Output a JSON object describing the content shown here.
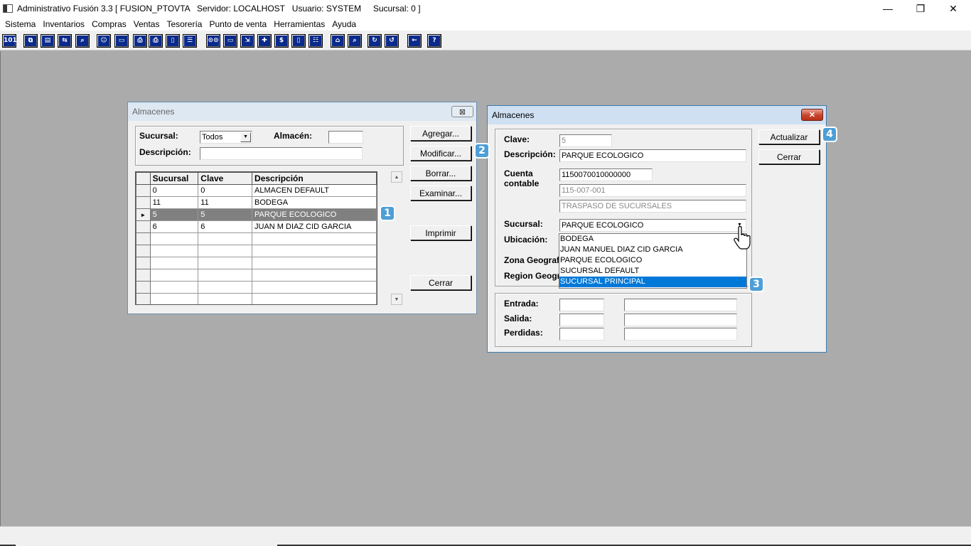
{
  "window": {
    "title": "Administrativo Fusión 3.3 [ FUSION_PTOVTA   Servidor: LOCALHOST   Usuario: SYSTEM     Sucursal: 0 ]",
    "minimize_glyph": "—",
    "maximize_glyph": "❐",
    "close_glyph": "✕"
  },
  "menu": [
    "Sistema",
    "Inventarios",
    "Compras",
    "Ventas",
    "Tesorería",
    "Punto de venta",
    "Herramientas",
    "Ayuda"
  ],
  "toolbar": {
    "icons": [
      "calculator-icon",
      "copy-icon",
      "clipboard-icon",
      "exchange-icon",
      "search-icon",
      "user-icon",
      "folder-icon",
      "print-icon",
      "printer-icon",
      "document-icon",
      "list-icon",
      "binoculars-icon",
      "box-icon",
      "export-icon",
      "add-icon",
      "dollar-icon",
      "report-icon",
      "table-icon",
      "home-icon",
      "zoom-icon",
      "refresh-icon",
      "undo-icon",
      "back-icon",
      "help-icon"
    ],
    "glyphs": [
      "101",
      "⧉",
      "▤",
      "⇆",
      "⌕",
      "☺",
      "▭",
      "⎙",
      "⎙",
      "▯",
      "☰",
      "⊙⊙",
      "▭",
      "⇲",
      "✚",
      "$",
      "▯",
      "☷",
      "⌂",
      "⌕",
      "↻",
      "↺",
      "←",
      "?"
    ]
  },
  "list_dialog": {
    "title": "Almacenes",
    "close_glyph": "⊠",
    "sucursal_label": "Sucursal:",
    "sucursal_value": "Todos",
    "almacen_label": "Almacén:",
    "almacen_value": "",
    "descripcion_label": "Descripción:",
    "descripcion_value": "",
    "columns": [
      "Sucursal",
      "Clave",
      "Descripción"
    ],
    "rows": [
      {
        "sucursal": "0",
        "clave": "0",
        "descripcion": "ALMACEN DEFAULT"
      },
      {
        "sucursal": "11",
        "clave": "11",
        "descripcion": "BODEGA"
      },
      {
        "sucursal": "5",
        "clave": "5",
        "descripcion": "PARQUE ECOLOGICO"
      },
      {
        "sucursal": "6",
        "clave": "6",
        "descripcion": "JUAN M DIAZ CID GARCIA"
      }
    ],
    "selected_row_marker": "►",
    "buttons": {
      "agregar": "Agregar...",
      "modificar": "Modificar...",
      "borrar": "Borrar...",
      "examinar": "Examinar...",
      "imprimir": "Imprimir",
      "cerrar": "Cerrar"
    }
  },
  "edit_dialog": {
    "title": "Almacenes",
    "close_glyph": "✕",
    "clave_label": "Clave:",
    "clave_value": "5",
    "descripcion_label": "Descripción:",
    "descripcion_value": "PARQUE ECOLOGICO",
    "cuenta_label_1": "Cuenta",
    "cuenta_label_2": "contable",
    "cuenta_value": "1150070010000000",
    "cuenta_formatted": "115-007-001",
    "cuenta_nombre": "TRASPASO DE SUCURSALES",
    "sucursal_label": "Sucursal:",
    "sucursal_value": "PARQUE ECOLOGICO",
    "ubicacion_label": "Ubicación:",
    "zona_label": "Zona Geograf",
    "region_label": "Region Geogr",
    "sucursal_options": [
      "BODEGA",
      "JUAN MANUEL DIAZ CID GARCIA",
      "PARQUE ECOLOGICO",
      "SUCURSAL DEFAULT",
      "SUCURSAL PRINCIPAL"
    ],
    "highlighted_option": "SUCURSAL PRINCIPAL",
    "entrada_label": "Entrada:",
    "salida_label": "Salida:",
    "perdidas_label": "Perdidas:",
    "buttons": {
      "actualizar": "Actualizar",
      "cerrar": "Cerrar"
    }
  },
  "badges": [
    "1",
    "2",
    "3",
    "4"
  ],
  "colors": {
    "selection": "#0078d7",
    "badge": "#4d9fd6",
    "row_selected": "#808080",
    "close_red": "#c9432b"
  }
}
